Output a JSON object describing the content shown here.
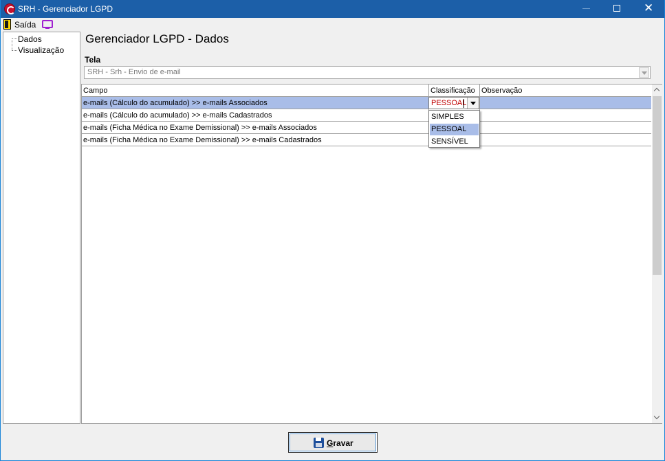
{
  "window": {
    "title": "SRH - Gerenciador LGPD"
  },
  "menu": {
    "exit_label": "Saída"
  },
  "tree": {
    "items": [
      "Dados",
      "Visualização"
    ]
  },
  "main": {
    "page_title": "Gerenciador LGPD - Dados",
    "tela_label": "Tela",
    "tela_value": "SRH - Srh - Envio de e-mail"
  },
  "grid": {
    "columns": [
      "Campo",
      "Classificação",
      "Observação"
    ],
    "rows": [
      {
        "campo": "e-mails (Cálculo do acumulado) >> e-mails Associados",
        "classificacao": "PESSOAL",
        "observacao": ""
      },
      {
        "campo": "e-mails (Cálculo do acumulado) >> e-mails Cadastrados",
        "classificacao": "",
        "observacao": ""
      },
      {
        "campo": "e-mails (Ficha Médica no Exame Demissional) >> e-mails Associados",
        "classificacao": "",
        "observacao": ""
      },
      {
        "campo": "e-mails (Ficha Médica no Exame Demissional) >> e-mails Cadastrados",
        "classificacao": "",
        "observacao": ""
      }
    ],
    "editor_value": "PESSOAL",
    "dropdown_options": [
      "SIMPLES",
      "PESSOAL",
      "SENSÍVEL"
    ],
    "dropdown_highlighted": "PESSOAL"
  },
  "footer": {
    "save_first": "G",
    "save_rest": "ravar"
  },
  "colors": {
    "titlebar": "#1c5fa8",
    "selection": "#a9bde8",
    "editor_text": "#c00000"
  }
}
